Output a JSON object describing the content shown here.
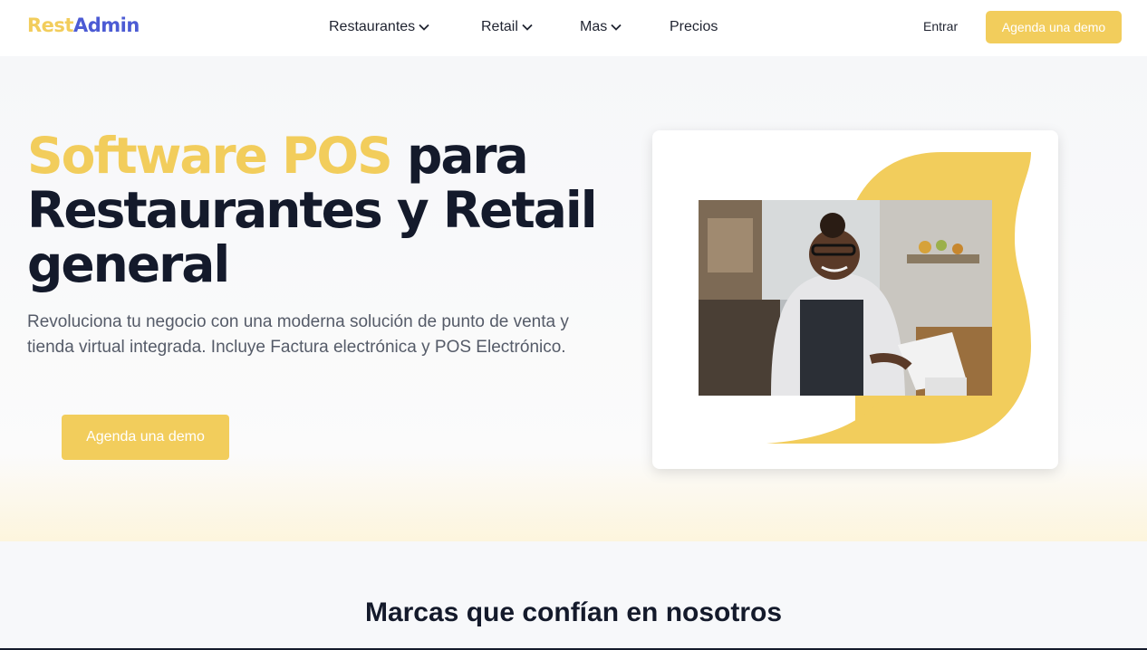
{
  "header": {
    "logo_part1": "Rest",
    "logo_part2": "Admin",
    "nav": [
      {
        "label": "Restaurantes"
      },
      {
        "label": "Retail"
      },
      {
        "label": "Mas"
      },
      {
        "label": "Precios"
      }
    ],
    "login_label": "Entrar",
    "demo_button_label": "Agenda una demo"
  },
  "hero": {
    "title_accent": "Software POS",
    "title_rest": " para Restaurantes y Retail general",
    "subtitle": "Revoluciona tu negocio con una moderna solución de punto de venta y tienda virtual integrada. Incluye Factura electrónica y POS Electrónico.",
    "cta_label": "Agenda una demo"
  },
  "brands": {
    "title": "Marcas que confían en nosotros"
  },
  "colors": {
    "accent": "#f2cd5c",
    "brand_blue": "#4c5bd4",
    "text_dark": "#141a2b"
  },
  "icons": {
    "dropdown": "chevron-down-icon"
  }
}
